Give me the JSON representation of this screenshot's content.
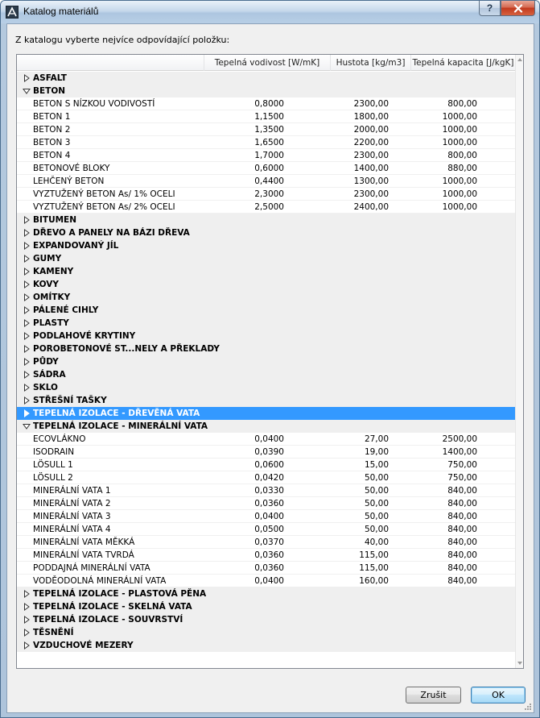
{
  "window": {
    "title": "Katalog materiálů",
    "help_label": "?",
    "prompt": "Z katalogu vyberte nejvíce odpovídající položku:"
  },
  "columns": [
    "",
    "Tepelná vodivost [W/mK]",
    "Hustota [kg/m3]",
    "Tepelná kapacita [J/kgK]"
  ],
  "rows": [
    {
      "kind": "group",
      "label": "ASFALT",
      "expanded": false
    },
    {
      "kind": "group",
      "label": "BETON",
      "expanded": true
    },
    {
      "kind": "item",
      "label": "BETON S NÍZKOU VODIVOSTÍ",
      "c1": "0,8000",
      "c2": "2300,00",
      "c3": "800,00"
    },
    {
      "kind": "item",
      "label": "BETON 1",
      "c1": "1,1500",
      "c2": "1800,00",
      "c3": "1000,00"
    },
    {
      "kind": "item",
      "label": "BETON 2",
      "c1": "1,3500",
      "c2": "2000,00",
      "c3": "1000,00"
    },
    {
      "kind": "item",
      "label": "BETON 3",
      "c1": "1,6500",
      "c2": "2200,00",
      "c3": "1000,00"
    },
    {
      "kind": "item",
      "label": "BETON 4",
      "c1": "1,7000",
      "c2": "2300,00",
      "c3": "800,00"
    },
    {
      "kind": "item",
      "label": "BETONOVÉ BLOKY",
      "c1": "0,6000",
      "c2": "1400,00",
      "c3": "880,00"
    },
    {
      "kind": "item",
      "label": "LEHČENÝ BETON",
      "c1": "0,4400",
      "c2": "1300,00",
      "c3": "1000,00"
    },
    {
      "kind": "item",
      "label": "VYZTUŽENÝ BETON As/ 1% OCELI",
      "c1": "2,3000",
      "c2": "2300,00",
      "c3": "1000,00"
    },
    {
      "kind": "item",
      "label": "VYZTUŽENÝ BETON As/ 2% OCELI",
      "c1": "2,5000",
      "c2": "2400,00",
      "c3": "1000,00"
    },
    {
      "kind": "group",
      "label": "BITUMEN",
      "expanded": false
    },
    {
      "kind": "group",
      "label": "DŘEVO A PANELY NA BÁZI DŘEVA",
      "expanded": false
    },
    {
      "kind": "group",
      "label": "EXPANDOVANÝ JÍL",
      "expanded": false
    },
    {
      "kind": "group",
      "label": "GUMY",
      "expanded": false
    },
    {
      "kind": "group",
      "label": "KAMENY",
      "expanded": false
    },
    {
      "kind": "group",
      "label": "KOVY",
      "expanded": false
    },
    {
      "kind": "group",
      "label": "OMÍTKY",
      "expanded": false
    },
    {
      "kind": "group",
      "label": "PÁLENÉ CIHLY",
      "expanded": false
    },
    {
      "kind": "group",
      "label": "PLASTY",
      "expanded": false
    },
    {
      "kind": "group",
      "label": "PODLAHOVÉ KRYTINY",
      "expanded": false
    },
    {
      "kind": "group",
      "label": "POROBETONOVÉ ST...NELY A PŘEKLADY",
      "expanded": false
    },
    {
      "kind": "group",
      "label": "PŮDY",
      "expanded": false
    },
    {
      "kind": "group",
      "label": "SÁDRA",
      "expanded": false
    },
    {
      "kind": "group",
      "label": "SKLO",
      "expanded": false
    },
    {
      "kind": "group",
      "label": "STŘEŠNÍ TAŠKY",
      "expanded": false
    },
    {
      "kind": "group",
      "label": "TEPELNÁ IZOLACE - DŘEVĚNÁ VATA",
      "expanded": false,
      "selected": true
    },
    {
      "kind": "group",
      "label": "TEPELNÁ IZOLACE - MINERÁLNÍ VATA",
      "expanded": true
    },
    {
      "kind": "item",
      "label": "ECOVLÁKNO",
      "c1": "0,0400",
      "c2": "27,00",
      "c3": "2500,00"
    },
    {
      "kind": "item",
      "label": "ISODRAIN",
      "c1": "0,0390",
      "c2": "19,00",
      "c3": "1400,00"
    },
    {
      "kind": "item",
      "label": "LÖSULL 1",
      "c1": "0,0600",
      "c2": "15,00",
      "c3": "750,00"
    },
    {
      "kind": "item",
      "label": "LÖSULL 2",
      "c1": "0,0420",
      "c2": "50,00",
      "c3": "750,00"
    },
    {
      "kind": "item",
      "label": "MINERÁLNÍ VATA 1",
      "c1": "0,0330",
      "c2": "50,00",
      "c3": "840,00"
    },
    {
      "kind": "item",
      "label": "MINERÁLNÍ VATA 2",
      "c1": "0,0360",
      "c2": "50,00",
      "c3": "840,00"
    },
    {
      "kind": "item",
      "label": "MINERÁLNÍ VATA 3",
      "c1": "0,0400",
      "c2": "50,00",
      "c3": "840,00"
    },
    {
      "kind": "item",
      "label": "MINERÁLNÍ VATA 4",
      "c1": "0,0500",
      "c2": "50,00",
      "c3": "840,00"
    },
    {
      "kind": "item",
      "label": "MINERÁLNÍ VATA MĚKKÁ",
      "c1": "0,0370",
      "c2": "40,00",
      "c3": "840,00"
    },
    {
      "kind": "item",
      "label": "MINERÁLNÍ VATA TVRDÁ",
      "c1": "0,0360",
      "c2": "115,00",
      "c3": "840,00"
    },
    {
      "kind": "item",
      "label": "PODDAJNÁ MINERÁLNÍ VATA",
      "c1": "0,0360",
      "c2": "115,00",
      "c3": "840,00"
    },
    {
      "kind": "item",
      "label": "VODĚODOLNÁ MINERÁLNÍ VATA",
      "c1": "0,0400",
      "c2": "160,00",
      "c3": "840,00"
    },
    {
      "kind": "group",
      "label": "TEPELNÁ IZOLACE - PLASTOVÁ PĚNA",
      "expanded": false
    },
    {
      "kind": "group",
      "label": "TEPELNÁ IZOLACE - SKELNÁ VATA",
      "expanded": false
    },
    {
      "kind": "group",
      "label": "TEPELNÁ IZOLACE - SOUVRSTVÍ",
      "expanded": false
    },
    {
      "kind": "group",
      "label": "TĚSNĚNÍ",
      "expanded": false
    },
    {
      "kind": "group",
      "label": "VZDUCHOVÉ MEZERY",
      "expanded": false
    }
  ],
  "buttons": {
    "cancel": "Zrušit",
    "ok": "OK"
  },
  "colors": {
    "selection": "#3399ff",
    "group_row": "#efefef"
  }
}
